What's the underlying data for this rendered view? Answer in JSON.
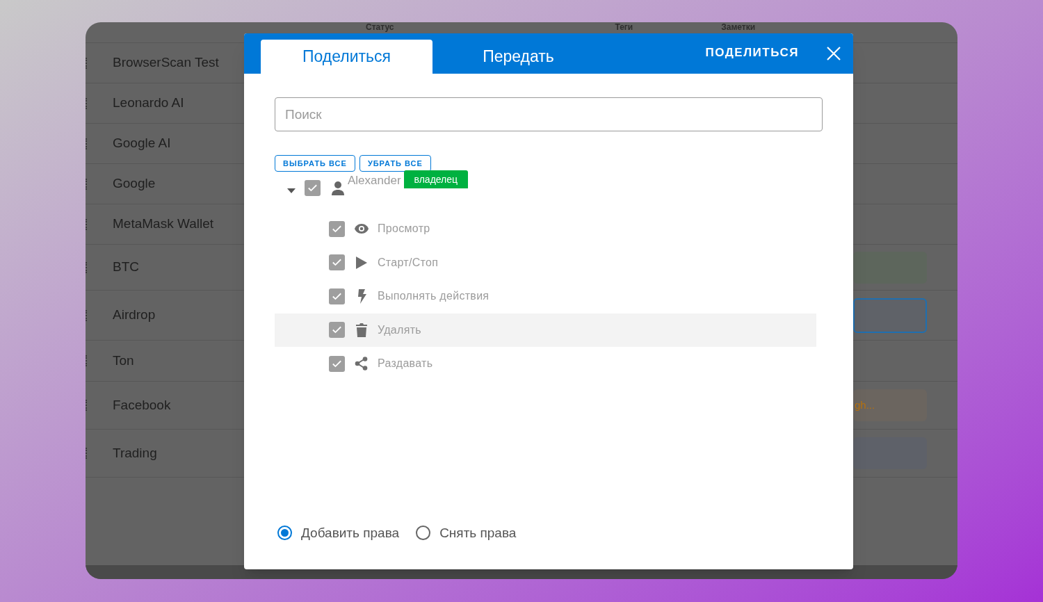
{
  "background_table": {
    "columns": [
      {
        "label": "Статус"
      },
      {
        "label": "Теги"
      },
      {
        "label": "Заметки"
      }
    ],
    "rows": [
      {
        "name": "BrowserScan Test"
      },
      {
        "name": "Leonardo AI"
      },
      {
        "name": "Google AI"
      },
      {
        "name": "Google"
      },
      {
        "name": "MetaMask Wallet"
      },
      {
        "name": "BTC",
        "note": {
          "kind": "filled",
          "color": "#5d665c"
        }
      },
      {
        "name": "Airdrop",
        "note": {
          "kind": "outlined",
          "color": "#5f6268"
        }
      },
      {
        "name": "Ton"
      },
      {
        "name": "Facebook",
        "note": {
          "kind": "filled",
          "color": "#6b655f",
          "text": "gh..."
        }
      },
      {
        "name": "Trading",
        "note": {
          "kind": "filled",
          "color": "#5e6169"
        }
      }
    ]
  },
  "dialog": {
    "tabs": [
      {
        "label": "Поделиться",
        "selected": true
      },
      {
        "label": "Передать",
        "selected": false
      }
    ],
    "action": "ПОДЕЛИТЬСЯ",
    "search": {
      "placeholder": "Поиск"
    },
    "buttons": [
      "ВЫБРАТЬ ВСЕ",
      "УБРАТЬ ВСЕ"
    ],
    "users": [
      {
        "name": "Alexander",
        "badge": "владелец",
        "expanded": true,
        "checked": true,
        "children": [
          {
            "kind": "view",
            "label": "Просмотр",
            "checked": true,
            "highlighted": false
          },
          {
            "kind": "start",
            "label": "Старт/Стоп",
            "checked": true,
            "highlighted": false
          },
          {
            "kind": "actions",
            "label": "Выполнять действия",
            "checked": true,
            "highlighted": false
          },
          {
            "kind": "delete",
            "label": "Удалять",
            "checked": true,
            "highlighted": true
          },
          {
            "kind": "share",
            "label": "Раздавать",
            "checked": true,
            "highlighted": false
          }
        ]
      }
    ],
    "modes": [
      {
        "label": "Добавить права",
        "selected": true
      },
      {
        "label": "Снять права",
        "selected": false
      }
    ]
  }
}
